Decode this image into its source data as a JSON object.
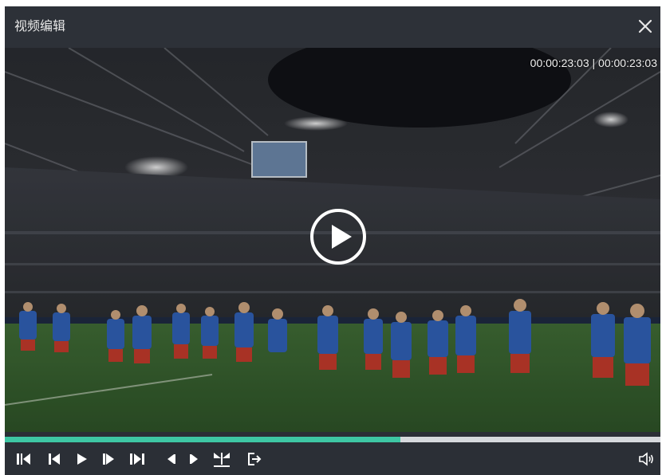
{
  "window": {
    "title": "视频编辑"
  },
  "player": {
    "time_display": "00:00:23:03 | 00:00:23:03",
    "progress_fraction": 0.603
  },
  "controls": {
    "buttons": [
      {
        "name": "go-to-start-icon"
      },
      {
        "name": "step-back-icon"
      },
      {
        "name": "play-icon"
      },
      {
        "name": "step-forward-icon"
      },
      {
        "name": "go-to-end-icon"
      },
      {
        "name": "mark-in-icon"
      },
      {
        "name": "mark-out-icon"
      },
      {
        "name": "split-icon"
      },
      {
        "name": "export-icon"
      }
    ],
    "volume_icon": "volume-icon"
  },
  "colors": {
    "accent": "#3ec7a4",
    "background": "#2b2f36",
    "track": "#d6d9dd"
  }
}
